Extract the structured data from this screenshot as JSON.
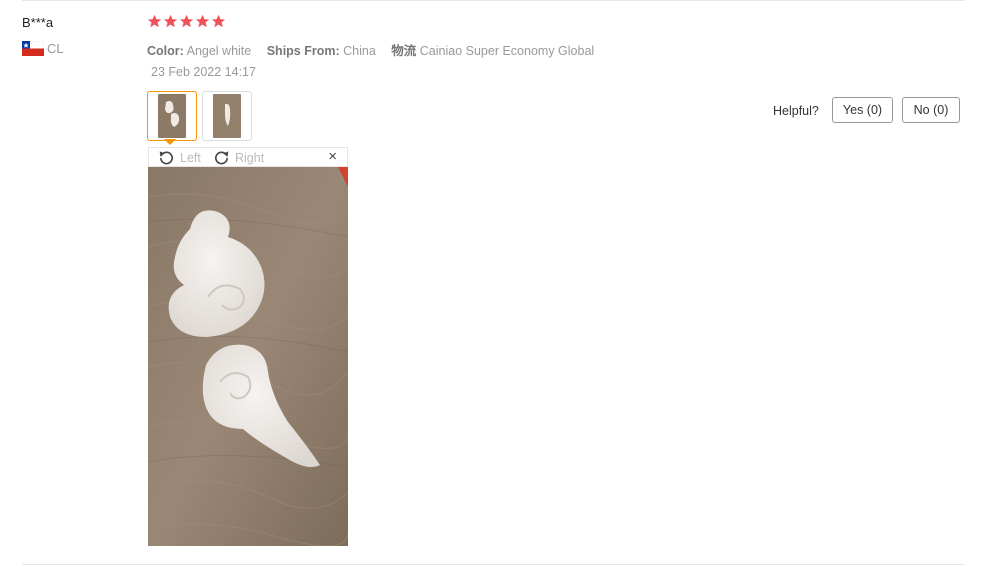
{
  "review": {
    "user_name": "B***a",
    "country_code": "CL",
    "rating": 5,
    "rating_max": 5,
    "star_color": "#f4505a",
    "attributes": [
      {
        "key": "Color:",
        "value": "Angel white"
      },
      {
        "key": "Ships From:",
        "value": "China"
      },
      {
        "key": "物流",
        "value": "Cainiao Super Economy Global"
      }
    ],
    "date": "23 Feb 2022 14:17",
    "thumbnails": [
      {
        "icon": "photo-thumbnail-wings",
        "selected": true
      },
      {
        "icon": "photo-thumbnail-wing-single",
        "selected": false
      }
    ]
  },
  "viewer": {
    "rotate_left_label": "Left",
    "rotate_right_label": "Right",
    "close_label": "×",
    "image_icon": "felt-angel-wings-photo"
  },
  "helpful": {
    "label": "Helpful?",
    "yes_label": "Yes (0)",
    "no_label": "No (0)"
  },
  "colors": {
    "accent_orange": "#f39800",
    "divider": "#e8e8e8",
    "muted_text": "#999999"
  }
}
